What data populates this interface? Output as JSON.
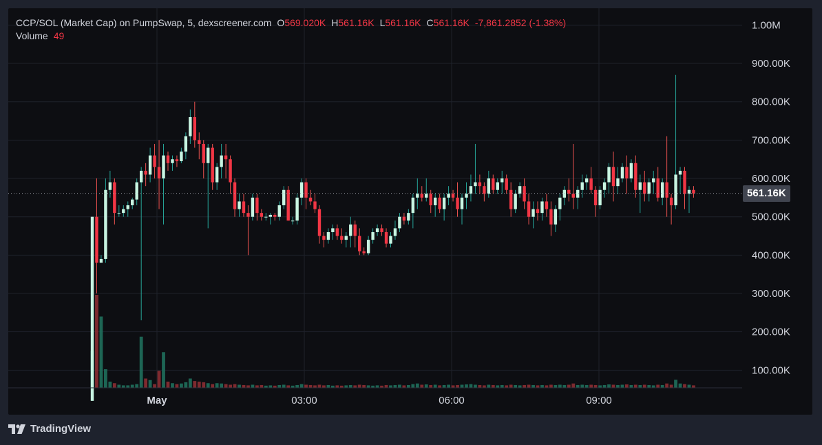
{
  "legend": {
    "title": "CCP/SOL (Market Cap) on PumpSwap, 5, dexscreener.com",
    "open_label": "O",
    "open_value": "569.020K",
    "high_label": "H",
    "high_value": "561.16K",
    "low_label": "L",
    "low_value": "561.16K",
    "close_label": "C",
    "close_value": "561.16K",
    "change": "-7,861.2852 (-1.38%)",
    "volume_label": "Volume",
    "volume_value": "49"
  },
  "price_tag": "561.16K",
  "brand": "TradingView",
  "colors": {
    "up": "#26a69a",
    "up_body": "#c8f5e2",
    "down": "#ef5350",
    "down_body": "#f23645",
    "background": "#0d0e12",
    "grid": "#1f222b",
    "text": "#d1d4dc"
  },
  "chart_data": {
    "type": "candlestick",
    "title": "CCP/SOL (Market Cap) on PumpSwap, 5, dexscreener.com",
    "interval": "5",
    "y_ticks": [
      "1.00M",
      "900.00K",
      "800.00K",
      "700.00K",
      "600.00K",
      "500.00K",
      "400.00K",
      "300.00K",
      "200.00K",
      "100.00K"
    ],
    "x_ticks": [
      "May",
      "03:00",
      "06:00",
      "09:00"
    ],
    "ylim": [
      0,
      1000000
    ],
    "last_price": 561160,
    "grid": true,
    "candles": [
      [
        20,
        500,
        20,
        500,
        120
      ],
      [
        500,
        600,
        300,
        380,
        300
      ],
      [
        380,
        400,
        380,
        390,
        230
      ],
      [
        390,
        600,
        380,
        570,
        60
      ],
      [
        570,
        620,
        550,
        590,
        20
      ],
      [
        590,
        600,
        480,
        510,
        15
      ],
      [
        510,
        530,
        500,
        510,
        10
      ],
      [
        510,
        530,
        500,
        520,
        8
      ],
      [
        520,
        540,
        500,
        530,
        8
      ],
      [
        530,
        550,
        520,
        545,
        10
      ],
      [
        545,
        600,
        530,
        590,
        12
      ],
      [
        590,
        630,
        230,
        620,
        165
      ],
      [
        620,
        640,
        580,
        610,
        30
      ],
      [
        610,
        680,
        590,
        660,
        25
      ],
      [
        660,
        690,
        600,
        630,
        12
      ],
      [
        630,
        700,
        520,
        600,
        55
      ],
      [
        600,
        690,
        480,
        660,
        115
      ],
      [
        660,
        670,
        620,
        640,
        20
      ],
      [
        640,
        660,
        620,
        650,
        15
      ],
      [
        650,
        660,
        630,
        645,
        12
      ],
      [
        645,
        680,
        640,
        670,
        14
      ],
      [
        670,
        720,
        650,
        710,
        18
      ],
      [
        710,
        780,
        690,
        760,
        30
      ],
      [
        760,
        800,
        680,
        700,
        22
      ],
      [
        700,
        720,
        650,
        690,
        20
      ],
      [
        690,
        700,
        600,
        640,
        18
      ],
      [
        640,
        690,
        470,
        680,
        15
      ],
      [
        680,
        690,
        570,
        590,
        12
      ],
      [
        590,
        640,
        570,
        630,
        15
      ],
      [
        630,
        690,
        600,
        660,
        14
      ],
      [
        660,
        690,
        600,
        650,
        12
      ],
      [
        650,
        660,
        560,
        590,
        10
      ],
      [
        590,
        600,
        500,
        520,
        12
      ],
      [
        520,
        560,
        500,
        540,
        10
      ],
      [
        540,
        560,
        500,
        510,
        9
      ],
      [
        510,
        530,
        400,
        500,
        8
      ],
      [
        500,
        560,
        490,
        550,
        10
      ],
      [
        550,
        560,
        490,
        510,
        8
      ],
      [
        510,
        520,
        490,
        500,
        9
      ],
      [
        500,
        510,
        490,
        500,
        7
      ],
      [
        500,
        510,
        480,
        505,
        8
      ],
      [
        505,
        510,
        490,
        500,
        7
      ],
      [
        500,
        540,
        490,
        530,
        9
      ],
      [
        530,
        580,
        520,
        570,
        10
      ],
      [
        570,
        580,
        490,
        490,
        8
      ],
      [
        490,
        500,
        480,
        490,
        7
      ],
      [
        490,
        560,
        480,
        550,
        9
      ],
      [
        550,
        600,
        530,
        590,
        12
      ],
      [
        590,
        600,
        520,
        550,
        10
      ],
      [
        550,
        570,
        530,
        540,
        9
      ],
      [
        540,
        560,
        510,
        520,
        8
      ],
      [
        520,
        530,
        430,
        450,
        10
      ],
      [
        450,
        460,
        420,
        440,
        8
      ],
      [
        440,
        470,
        430,
        460,
        9
      ],
      [
        460,
        480,
        440,
        470,
        7
      ],
      [
        470,
        480,
        440,
        450,
        8
      ],
      [
        450,
        470,
        430,
        440,
        7
      ],
      [
        440,
        460,
        420,
        450,
        8
      ],
      [
        450,
        500,
        420,
        480,
        9
      ],
      [
        480,
        490,
        420,
        450,
        8
      ],
      [
        450,
        470,
        400,
        410,
        10
      ],
      [
        410,
        420,
        400,
        405,
        9
      ],
      [
        405,
        450,
        400,
        440,
        8
      ],
      [
        440,
        470,
        430,
        460,
        7
      ],
      [
        460,
        480,
        450,
        470,
        8
      ],
      [
        470,
        480,
        450,
        460,
        7
      ],
      [
        460,
        470,
        420,
        430,
        9
      ],
      [
        430,
        460,
        420,
        450,
        8
      ],
      [
        450,
        490,
        440,
        470,
        9
      ],
      [
        470,
        510,
        460,
        500,
        10
      ],
      [
        500,
        510,
        480,
        490,
        8
      ],
      [
        490,
        520,
        480,
        510,
        9
      ],
      [
        510,
        560,
        470,
        550,
        12
      ],
      [
        550,
        600,
        520,
        560,
        14
      ],
      [
        560,
        580,
        540,
        550,
        10
      ],
      [
        550,
        600,
        540,
        560,
        11
      ],
      [
        560,
        570,
        510,
        530,
        9
      ],
      [
        530,
        560,
        500,
        550,
        10
      ],
      [
        550,
        560,
        510,
        520,
        8
      ],
      [
        520,
        560,
        490,
        550,
        9
      ],
      [
        550,
        580,
        530,
        560,
        10
      ],
      [
        560,
        570,
        540,
        550,
        8
      ],
      [
        550,
        590,
        500,
        520,
        9
      ],
      [
        520,
        560,
        480,
        550,
        10
      ],
      [
        550,
        590,
        520,
        560,
        11
      ],
      [
        560,
        610,
        540,
        580,
        12
      ],
      [
        580,
        690,
        560,
        590,
        10
      ],
      [
        590,
        610,
        560,
        580,
        9
      ],
      [
        580,
        590,
        540,
        560,
        8
      ],
      [
        560,
        620,
        550,
        600,
        10
      ],
      [
        600,
        610,
        560,
        570,
        9
      ],
      [
        570,
        600,
        560,
        590,
        8
      ],
      [
        590,
        620,
        560,
        600,
        9
      ],
      [
        600,
        610,
        560,
        570,
        8
      ],
      [
        570,
        590,
        500,
        520,
        10
      ],
      [
        520,
        570,
        510,
        560,
        9
      ],
      [
        560,
        590,
        550,
        580,
        8
      ],
      [
        580,
        600,
        520,
        540,
        9
      ],
      [
        540,
        560,
        480,
        500,
        10
      ],
      [
        500,
        540,
        470,
        520,
        9
      ],
      [
        520,
        540,
        490,
        510,
        8
      ],
      [
        510,
        550,
        490,
        540,
        9
      ],
      [
        540,
        560,
        500,
        520,
        8
      ],
      [
        520,
        540,
        450,
        480,
        10
      ],
      [
        480,
        530,
        460,
        520,
        9
      ],
      [
        520,
        560,
        490,
        550,
        10
      ],
      [
        550,
        580,
        530,
        570,
        9
      ],
      [
        570,
        600,
        540,
        560,
        10
      ],
      [
        560,
        690,
        520,
        550,
        14
      ],
      [
        550,
        580,
        520,
        570,
        9
      ],
      [
        570,
        610,
        550,
        590,
        10
      ],
      [
        590,
        610,
        570,
        600,
        9
      ],
      [
        600,
        630,
        560,
        570,
        10
      ],
      [
        570,
        580,
        500,
        530,
        9
      ],
      [
        530,
        580,
        520,
        570,
        8
      ],
      [
        570,
        600,
        550,
        590,
        9
      ],
      [
        590,
        640,
        560,
        630,
        11
      ],
      [
        630,
        670,
        540,
        580,
        10
      ],
      [
        580,
        630,
        560,
        600,
        9
      ],
      [
        600,
        640,
        590,
        630,
        10
      ],
      [
        630,
        660,
        560,
        600,
        11
      ],
      [
        600,
        650,
        590,
        640,
        9
      ],
      [
        640,
        660,
        550,
        570,
        10
      ],
      [
        570,
        610,
        510,
        590,
        9
      ],
      [
        590,
        620,
        540,
        560,
        10
      ],
      [
        560,
        600,
        540,
        590,
        9
      ],
      [
        590,
        620,
        560,
        600,
        8
      ],
      [
        600,
        630,
        540,
        550,
        10
      ],
      [
        550,
        600,
        530,
        590,
        9
      ],
      [
        590,
        710,
        500,
        550,
        14
      ],
      [
        550,
        560,
        480,
        530,
        10
      ],
      [
        530,
        870,
        520,
        610,
        26
      ],
      [
        610,
        630,
        560,
        620,
        14
      ],
      [
        620,
        630,
        520,
        560,
        12
      ],
      [
        560,
        580,
        510,
        570,
        10
      ],
      [
        570,
        580,
        550,
        561,
        8
      ]
    ]
  }
}
